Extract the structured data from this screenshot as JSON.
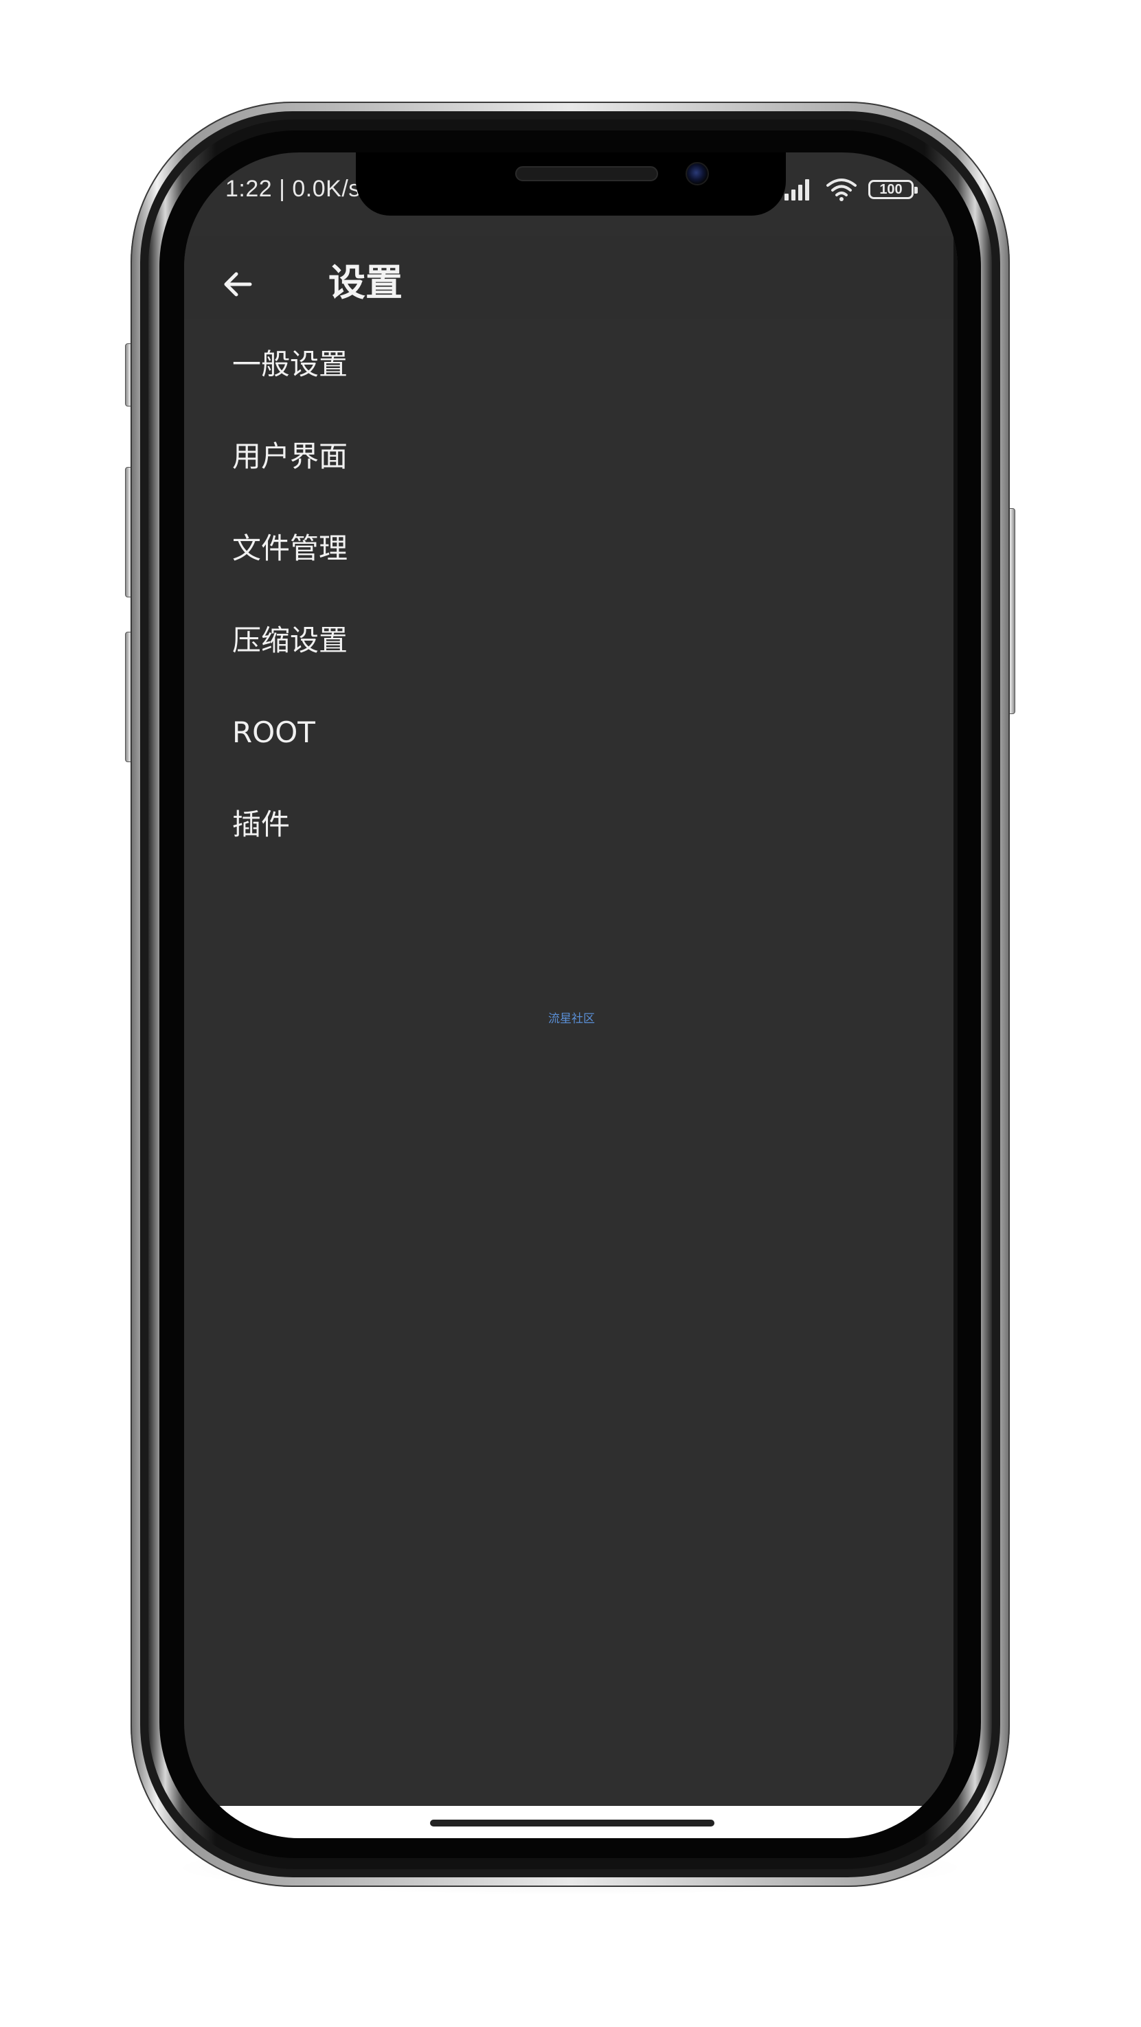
{
  "status_bar": {
    "time_text": "1:22 | 0.0K/s",
    "battery_level": "100"
  },
  "toolbar": {
    "title": "设置"
  },
  "settings": {
    "items": [
      {
        "label": "一般设置"
      },
      {
        "label": "用户界面"
      },
      {
        "label": "文件管理"
      },
      {
        "label": "压缩设置"
      },
      {
        "label": "ROOT"
      },
      {
        "label": "插件"
      }
    ]
  },
  "watermark": {
    "text": "流星社区"
  },
  "colors": {
    "screen_background": "#2f2f2f",
    "text_primary": "#f1f1f1",
    "watermark": "#5a8fd6"
  },
  "icons": {
    "back": "arrow-left-icon",
    "signal": "cellular-signal-icon",
    "wifi": "wifi-icon",
    "battery": "battery-icon"
  }
}
